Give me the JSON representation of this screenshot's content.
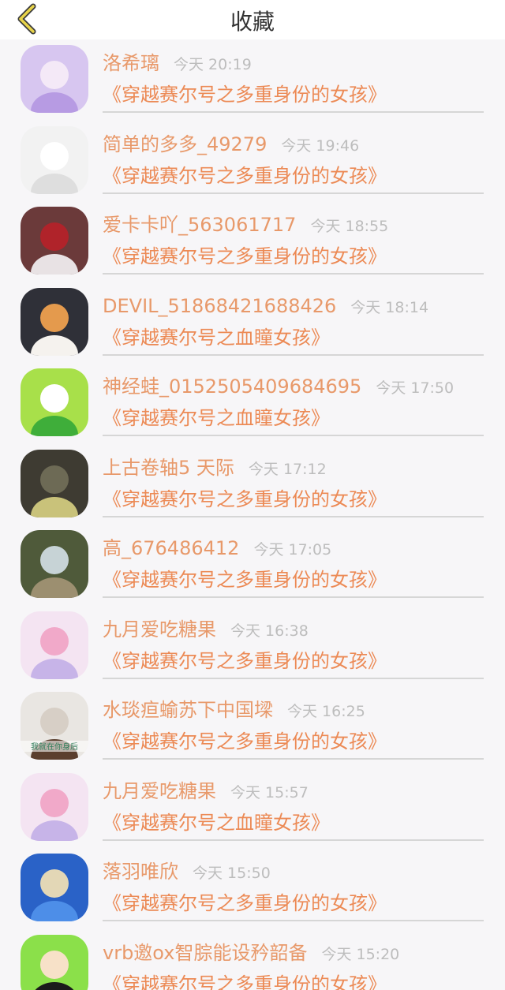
{
  "header": {
    "title": "收藏"
  },
  "items": [
    {
      "name": "洛希璃",
      "time": "今天 20:19",
      "book": "《穿越赛尔号之多重身份的女孩》",
      "avatar_colors": [
        "#d7c6f0",
        "#b79be3",
        "#f4e9f7"
      ]
    },
    {
      "name": "简单的多多_49279",
      "time": "今天 19:46",
      "book": "《穿越赛尔号之多重身份的女孩》",
      "avatar_colors": [
        "#f2f2f2",
        "#dedede",
        "#ffffff"
      ]
    },
    {
      "name": "爱卡卡吖_563061717",
      "time": "今天 18:55",
      "book": "《穿越赛尔号之多重身份的女孩》",
      "avatar_colors": [
        "#6b3a3a",
        "#e8e2e4",
        "#b0232a"
      ]
    },
    {
      "name": "DEVIL_51868421688426",
      "time": "今天 18:14",
      "book": "《穿越赛尔号之血瞳女孩》",
      "avatar_colors": [
        "#2f3038",
        "#f5f2ee",
        "#e49a4d"
      ]
    },
    {
      "name": "神经蛙_0152505409684695",
      "time": "今天 17:50",
      "book": "《穿越赛尔号之血瞳女孩》",
      "avatar_colors": [
        "#a8e04a",
        "#3fae3a",
        "#ffffff"
      ]
    },
    {
      "name": "上古卷轴5 天际",
      "time": "今天 17:12",
      "book": "《穿越赛尔号之多重身份的女孩》",
      "avatar_colors": [
        "#3e3b32",
        "#c9c27a",
        "#6d6a55"
      ]
    },
    {
      "name": "高_676486412",
      "time": "今天 17:05",
      "book": "《穿越赛尔号之多重身份的女孩》",
      "avatar_colors": [
        "#4f5a3a",
        "#9c8f70",
        "#c7d3d6"
      ]
    },
    {
      "name": "九月爱吃糖果",
      "time": "今天 16:38",
      "book": "《穿越赛尔号之多重身份的女孩》",
      "avatar_colors": [
        "#f4e4f2",
        "#c7b4e8",
        "#f1a9c9"
      ]
    },
    {
      "name": "水琰疸蝓苏下中国墚",
      "time": "今天 16:25",
      "book": "《穿越赛尔号之多重身份的女孩》",
      "avatar_colors": [
        "#e9e6e2",
        "#5b3f2e",
        "#d7cfc6"
      ],
      "avatar_caption": "我就在你身后"
    },
    {
      "name": "九月爱吃糖果",
      "time": "今天 15:57",
      "book": "《穿越赛尔号之血瞳女孩》",
      "avatar_colors": [
        "#f4e4f2",
        "#c7b4e8",
        "#f1a9c9"
      ]
    },
    {
      "name": "落羽唯欣",
      "time": "今天 15:50",
      "book": "《穿越赛尔号之多重身份的女孩》",
      "avatar_colors": [
        "#2a62c7",
        "#4d8ee8",
        "#e3d7b6"
      ]
    },
    {
      "name": "vrb邀ox智腙能设矜韶备",
      "time": "今天 15:20",
      "book": "《穿越赛尔号之多重身份的女孩》",
      "avatar_colors": [
        "#8be04a",
        "#1b1b1b",
        "#f7e1c8"
      ]
    }
  ]
}
